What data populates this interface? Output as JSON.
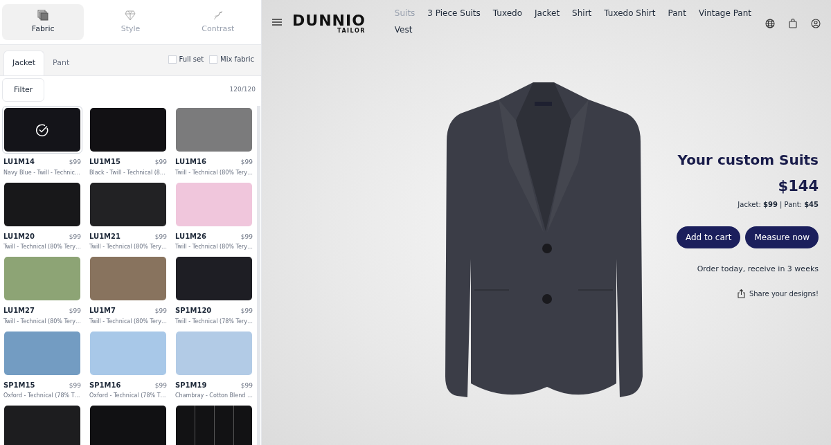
{
  "panel_tabs": [
    {
      "label": "Fabric",
      "selected": true
    },
    {
      "label": "Style",
      "selected": false
    },
    {
      "label": "Contrast",
      "selected": false
    }
  ],
  "garment_tabs": [
    {
      "label": "Jacket",
      "selected": true
    },
    {
      "label": "Pant",
      "selected": false
    }
  ],
  "options": [
    {
      "label": "Full set",
      "checked": false
    },
    {
      "label": "Mix fabric",
      "checked": false
    }
  ],
  "filter_button": "Filter",
  "count": "120/120",
  "fabrics": [
    {
      "code": "LU1M14",
      "price": "$99",
      "description": "Navy Blue - Twill - Technic…",
      "color": "#141419",
      "selected": true
    },
    {
      "code": "LU1M15",
      "price": "$99",
      "description": "Black - Twill - Technical (8…",
      "color": "#121114",
      "selected": false
    },
    {
      "code": "LU1M16",
      "price": "$99",
      "description": "Twill - Technical (80% Tery…",
      "color": "#7b7b7c",
      "selected": false
    },
    {
      "code": "LU1M20",
      "price": "$99",
      "description": "Twill - Technical (80% Tery…",
      "color": "#18181a",
      "selected": false
    },
    {
      "code": "LU1M21",
      "price": "$99",
      "description": "Twill - Technical (80% Tery…",
      "color": "#222224",
      "selected": false
    },
    {
      "code": "LU1M26",
      "price": "$99",
      "description": "Twill - Technical (80% Tery…",
      "color": "#f0c6dc",
      "selected": false
    },
    {
      "code": "LU1M27",
      "price": "$99",
      "description": "Twill - Technical (80% Tery…",
      "color": "#8da475",
      "selected": false
    },
    {
      "code": "LU1M7",
      "price": "$99",
      "description": "Twill - Technical (80% Tery…",
      "color": "#88735e",
      "selected": false
    },
    {
      "code": "SP1M120",
      "price": "$99",
      "description": "Twill - Technical (78% Tery…",
      "color": "#1e1e24",
      "selected": false
    },
    {
      "code": "SP1M15",
      "price": "$99",
      "description": "Oxford - Technical (78% T…",
      "color": "#739cc2",
      "selected": false
    },
    {
      "code": "SP1M16",
      "price": "$99",
      "description": "Oxford - Technical (78% T…",
      "color": "#a8c8e8",
      "selected": false
    },
    {
      "code": "SP1M19",
      "price": "$99",
      "description": "Chambray - Cotton Blend …",
      "color": "#b2cbe6",
      "selected": false
    },
    {
      "color": "#1d1d1f",
      "selected": false
    },
    {
      "color": "#111113",
      "selected": false
    },
    {
      "color": "#121214",
      "selected": false,
      "kind": "pinstripe"
    }
  ],
  "brand": {
    "name": "DUNNIO",
    "subtitle": "TAILOR"
  },
  "nav": [
    {
      "label": "Suits",
      "selected": true
    },
    {
      "label": "3 Piece Suits",
      "selected": false
    },
    {
      "label": "Tuxedo",
      "selected": false
    },
    {
      "label": "Jacket",
      "selected": false
    },
    {
      "label": "Shirt",
      "selected": false
    },
    {
      "label": "Tuxedo Shirt",
      "selected": false
    },
    {
      "label": "Pant",
      "selected": false
    },
    {
      "label": "Vintage Pant",
      "selected": false
    },
    {
      "label": "Vest",
      "selected": false
    }
  ],
  "summary": {
    "title": "Your custom Suits",
    "total": "$144",
    "breakdown": "Jacket: **$99** | Pant: **$45**",
    "buttons": [
      "Add to cart",
      "Measure now"
    ],
    "delivery": "Order today, receive in 3 weeks",
    "share": "Share your designs!"
  }
}
